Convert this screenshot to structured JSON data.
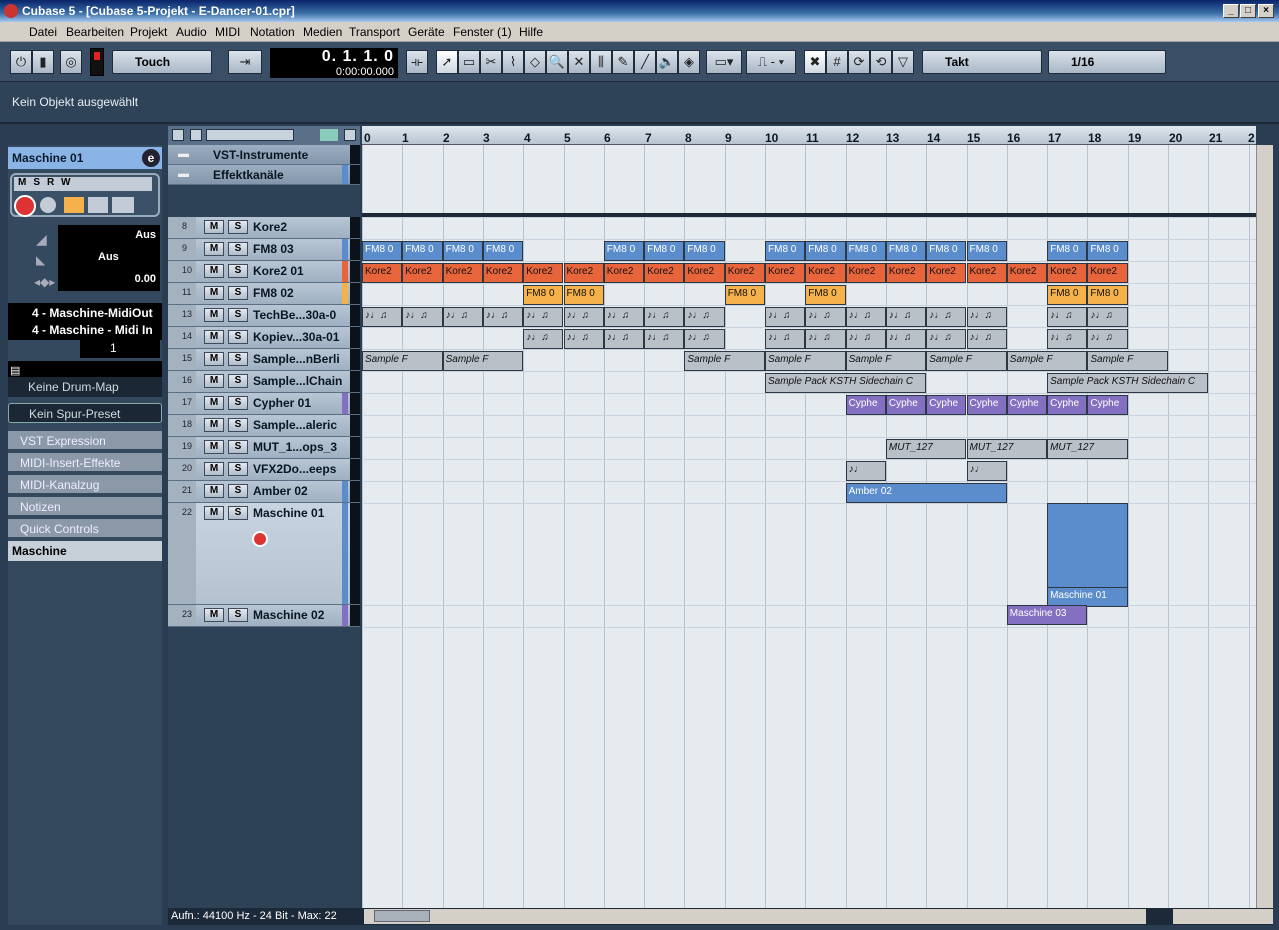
{
  "window": {
    "title": "Cubase 5 - [Cubase 5-Projekt - E-Dancer-01.cpr]"
  },
  "menu": [
    "Datei",
    "Bearbeiten",
    "Projekt",
    "Audio",
    "MIDI",
    "Notation",
    "Medien",
    "Transport",
    "Geräte",
    "Fenster (1)",
    "Hilfe"
  ],
  "toolbar": {
    "automation_mode": "Touch",
    "position_main": "0. 1. 1.    0",
    "position_time": "0:00:00.000",
    "grid_type": "Takt",
    "quantize": "1/16"
  },
  "info_line": "Kein Objekt ausgewählt",
  "inspector": {
    "track_name": "Maschine 01",
    "vol_a": "Aus",
    "vol_b": "Aus",
    "pan": "0.00",
    "midi_out": "4 - Maschine-MidiOut",
    "midi_in": "4 - Maschine - Midi In",
    "channel": "1",
    "drum_map": "Keine Drum-Map",
    "preset": "Kein Spur-Preset",
    "sections": [
      "VST Expression",
      "MIDI-Insert-Effekte",
      "MIDI-Kanalzug",
      "Notizen",
      "Quick Controls",
      "Maschine"
    ]
  },
  "tracks": [
    {
      "num": "",
      "name": "VST-Instrumente"
    },
    {
      "num": "",
      "name": "Effektkanäle"
    },
    {
      "num": "8",
      "name": "Kore2"
    },
    {
      "num": "9",
      "name": "FM8 03"
    },
    {
      "num": "10",
      "name": "Kore2 01"
    },
    {
      "num": "11",
      "name": "FM8 02"
    },
    {
      "num": "13",
      "name": "TechBe...30a-0"
    },
    {
      "num": "14",
      "name": "Kopiev...30a-01"
    },
    {
      "num": "15",
      "name": "Sample...nBerli"
    },
    {
      "num": "16",
      "name": "Sample...lChain"
    },
    {
      "num": "17",
      "name": "Cypher 01"
    },
    {
      "num": "18",
      "name": "Sample...aleric"
    },
    {
      "num": "19",
      "name": "MUT_1...ops_3"
    },
    {
      "num": "20",
      "name": "VFX2Do...eeps"
    },
    {
      "num": "21",
      "name": "Amber 02"
    },
    {
      "num": "22",
      "name": "Maschine 01"
    },
    {
      "num": "23",
      "name": "Maschine 02"
    }
  ],
  "ruler": [
    "0",
    "1",
    "2",
    "3",
    "4",
    "5",
    "6",
    "7",
    "8",
    "9",
    "10",
    "11",
    "12",
    "13",
    "14",
    "15",
    "16",
    "17",
    "18",
    "19",
    "20",
    "21",
    "2"
  ],
  "events": {
    "fm": "FM8 0",
    "kore": "Kore2",
    "sample_a": "Sample F",
    "sample_b": "Sample Pack KSTH Sidechain C",
    "cypher": "Cyphe",
    "mut": "MUT_127",
    "amber": "Amber 02",
    "maschine01": "Maschine 01",
    "maschine03": "Maschine 03"
  },
  "status": "Aufn.: 44100 Hz - 24 Bit - Max: 22",
  "colors": {
    "fm": "#5b8ccc",
    "kore": "#e8653c",
    "fm_orange": "#f5b14a",
    "purple": "#8370c0"
  }
}
